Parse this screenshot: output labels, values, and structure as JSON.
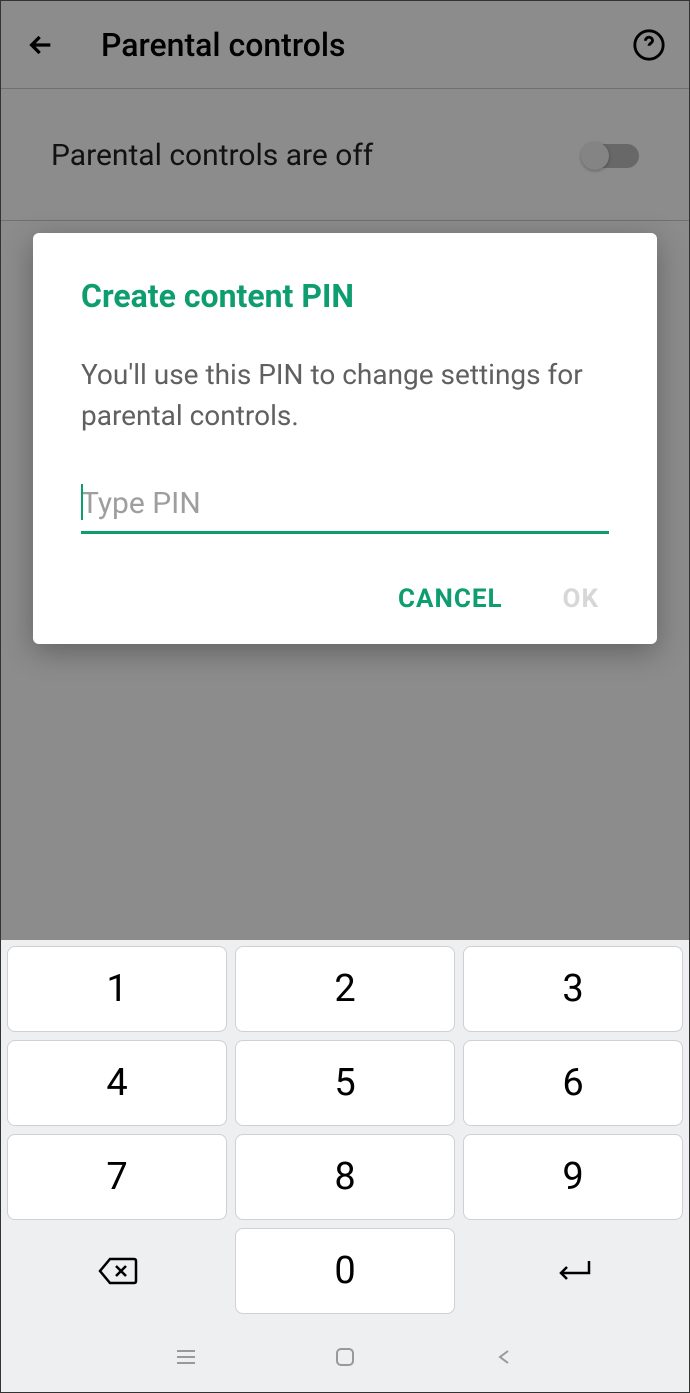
{
  "header": {
    "title": "Parental controls"
  },
  "status": {
    "text": "Parental controls are off"
  },
  "dialog": {
    "title": "Create content PIN",
    "body": "You'll use this PIN to change settings for parental controls.",
    "placeholder": "Type PIN",
    "cancel": "CANCEL",
    "ok": "OK"
  },
  "keypad": {
    "k1": "1",
    "k2": "2",
    "k3": "3",
    "k4": "4",
    "k5": "5",
    "k6": "6",
    "k7": "7",
    "k8": "8",
    "k9": "9",
    "k0": "0"
  }
}
